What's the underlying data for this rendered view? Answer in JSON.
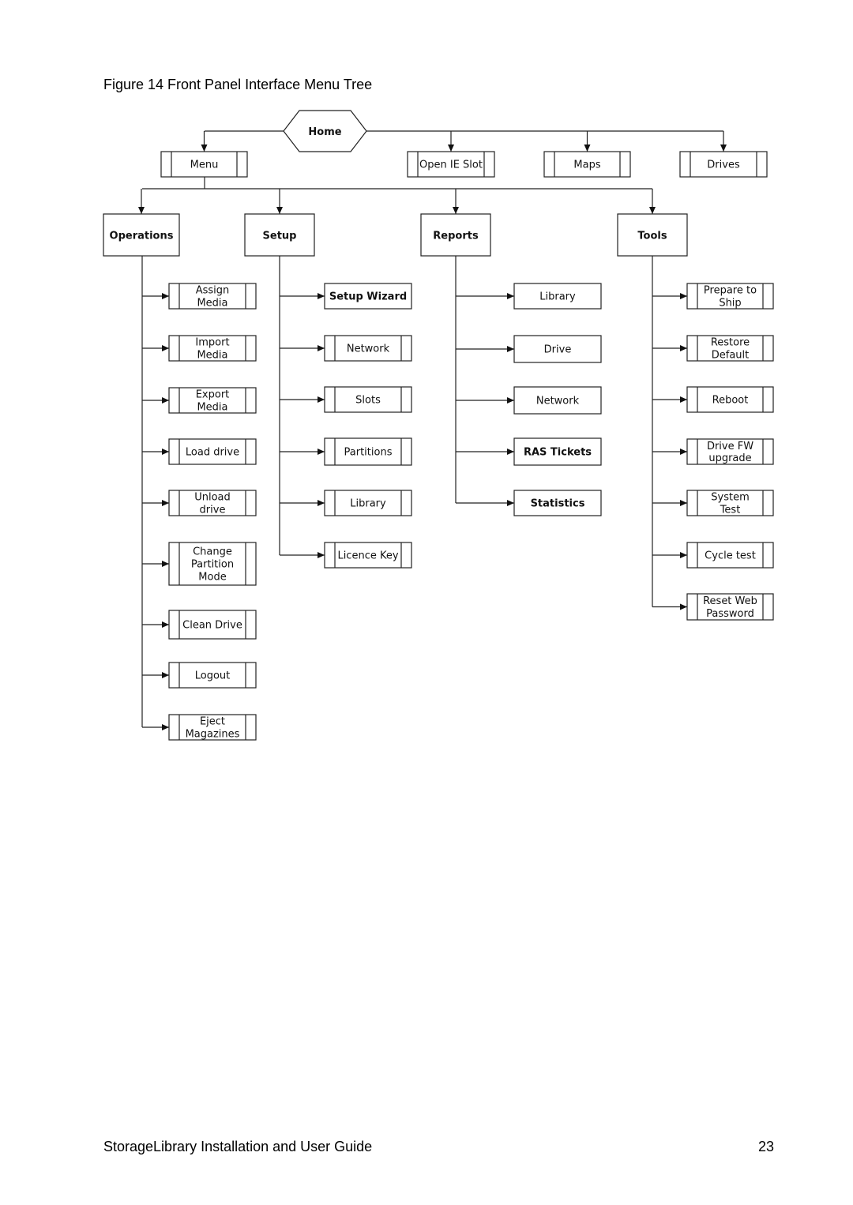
{
  "page": {
    "caption": "Figure 14 Front Panel Interface Menu Tree",
    "footer_title": "StorageLibrary Installation and User Guide",
    "page_number": "23"
  },
  "tree": {
    "root": "Home",
    "level1": [
      {
        "id": "menu",
        "label": [
          "Menu"
        ],
        "style": "subprocess"
      },
      {
        "id": "open-ie-slot",
        "label": [
          "Open IE Slot"
        ],
        "style": "subprocess"
      },
      {
        "id": "maps",
        "label": [
          "Maps"
        ],
        "style": "subprocess"
      },
      {
        "id": "drives",
        "label": [
          "Drives"
        ],
        "style": "subprocess"
      }
    ],
    "menu_children": [
      {
        "id": "operations",
        "label": [
          "Operations"
        ],
        "children": [
          {
            "label": [
              "Assign",
              "Media"
            ],
            "style": "subprocess"
          },
          {
            "label": [
              "Import",
              "Media"
            ],
            "style": "subprocess"
          },
          {
            "label": [
              "Export",
              "Media"
            ],
            "style": "subprocess"
          },
          {
            "label": [
              "Load drive"
            ],
            "style": "subprocess"
          },
          {
            "label": [
              "Unload",
              "drive"
            ],
            "style": "subprocess"
          },
          {
            "label": [
              "Change",
              "Partition",
              "Mode"
            ],
            "style": "subprocess"
          },
          {
            "label": [
              "Clean Drive"
            ],
            "style": "subprocess"
          },
          {
            "label": [
              "Logout"
            ],
            "style": "subprocess"
          },
          {
            "label": [
              "Eject",
              "Magazines"
            ],
            "style": "subprocess"
          }
        ]
      },
      {
        "id": "setup",
        "label": [
          "Setup"
        ],
        "children": [
          {
            "label": [
              "Setup Wizard"
            ],
            "style": "bold"
          },
          {
            "label": [
              "Network"
            ],
            "style": "subprocess"
          },
          {
            "label": [
              "Slots"
            ],
            "style": "subprocess"
          },
          {
            "label": [
              "Partitions"
            ],
            "style": "subprocess"
          },
          {
            "label": [
              "Library"
            ],
            "style": "subprocess"
          },
          {
            "label": [
              "Licence Key"
            ],
            "style": "subprocess"
          }
        ]
      },
      {
        "id": "reports",
        "label": [
          "Reports"
        ],
        "children": [
          {
            "label": [
              "Library"
            ],
            "style": "plain"
          },
          {
            "label": [
              "Drive"
            ],
            "style": "plain"
          },
          {
            "label": [
              "Network"
            ],
            "style": "plain"
          },
          {
            "label": [
              "RAS Tickets"
            ],
            "style": "bold"
          },
          {
            "label": [
              "Statistics"
            ],
            "style": "bold"
          }
        ]
      },
      {
        "id": "tools",
        "label": [
          "Tools"
        ],
        "children": [
          {
            "label": [
              "Prepare to",
              "Ship"
            ],
            "style": "subprocess"
          },
          {
            "label": [
              "Restore",
              "Default"
            ],
            "style": "subprocess"
          },
          {
            "label": [
              "Reboot"
            ],
            "style": "subprocess"
          },
          {
            "label": [
              "Drive FW",
              "upgrade"
            ],
            "style": "subprocess-small"
          },
          {
            "label": [
              "System",
              "Test"
            ],
            "style": "subprocess"
          },
          {
            "label": [
              "Cycle test"
            ],
            "style": "subprocess"
          },
          {
            "label": [
              "Reset Web",
              "Password"
            ],
            "style": "subprocess"
          }
        ]
      }
    ]
  }
}
